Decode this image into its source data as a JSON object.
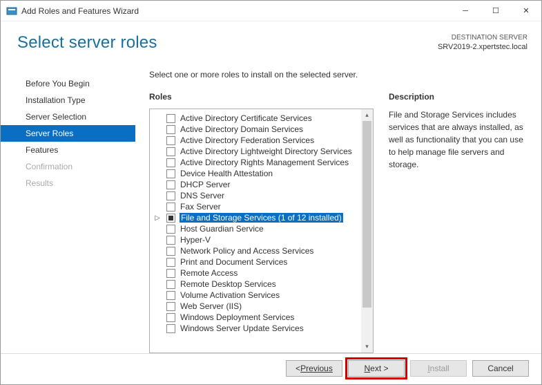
{
  "window": {
    "title": "Add Roles and Features Wizard"
  },
  "header": {
    "page_title": "Select server roles",
    "destination_label": "DESTINATION SERVER",
    "destination_server": "SRV2019-2.xpertstec.local"
  },
  "nav": {
    "items": [
      {
        "label": "Before You Begin",
        "state": "normal"
      },
      {
        "label": "Installation Type",
        "state": "normal"
      },
      {
        "label": "Server Selection",
        "state": "normal"
      },
      {
        "label": "Server Roles",
        "state": "active"
      },
      {
        "label": "Features",
        "state": "normal"
      },
      {
        "label": "Confirmation",
        "state": "disabled"
      },
      {
        "label": "Results",
        "state": "disabled"
      }
    ]
  },
  "main": {
    "instruction": "Select one or more roles to install on the selected server.",
    "roles_heading": "Roles",
    "description_heading": "Description",
    "description_text": "File and Storage Services includes services that are always installed, as well as functionality that you can use to help manage file servers and storage.",
    "roles": [
      {
        "label": "Active Directory Certificate Services",
        "checked": false
      },
      {
        "label": "Active Directory Domain Services",
        "checked": false
      },
      {
        "label": "Active Directory Federation Services",
        "checked": false
      },
      {
        "label": "Active Directory Lightweight Directory Services",
        "checked": false
      },
      {
        "label": "Active Directory Rights Management Services",
        "checked": false
      },
      {
        "label": "Device Health Attestation",
        "checked": false
      },
      {
        "label": "DHCP Server",
        "checked": false
      },
      {
        "label": "DNS Server",
        "checked": false
      },
      {
        "label": "Fax Server",
        "checked": false
      },
      {
        "label": "File and Storage Services (1 of 12 installed)",
        "checked": "partial",
        "selected": true,
        "expandable": true
      },
      {
        "label": "Host Guardian Service",
        "checked": false
      },
      {
        "label": "Hyper-V",
        "checked": false
      },
      {
        "label": "Network Policy and Access Services",
        "checked": false
      },
      {
        "label": "Print and Document Services",
        "checked": false
      },
      {
        "label": "Remote Access",
        "checked": false
      },
      {
        "label": "Remote Desktop Services",
        "checked": false
      },
      {
        "label": "Volume Activation Services",
        "checked": false
      },
      {
        "label": "Web Server (IIS)",
        "checked": false
      },
      {
        "label": "Windows Deployment Services",
        "checked": false
      },
      {
        "label": "Windows Server Update Services",
        "checked": false
      }
    ]
  },
  "footer": {
    "previous": "Previous",
    "next": "Next >",
    "install": "Install",
    "cancel": "Cancel"
  }
}
